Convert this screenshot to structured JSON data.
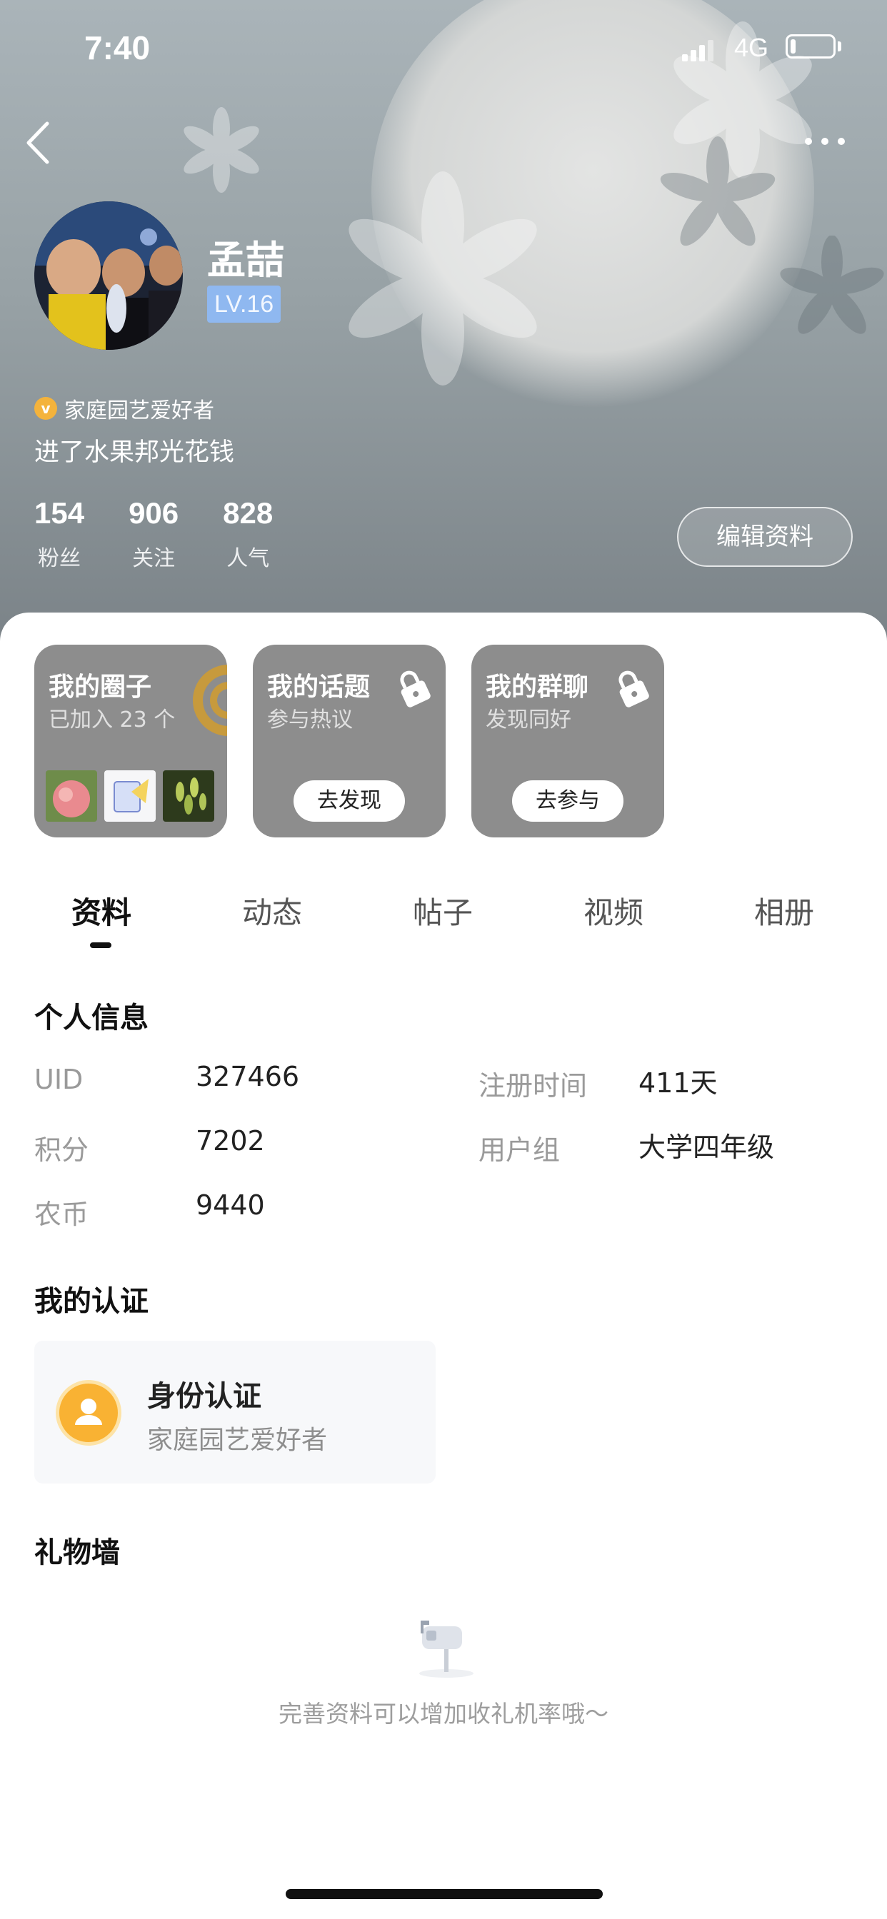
{
  "status_bar": {
    "time": "7:40",
    "network": "4G",
    "battery_level": 0.12
  },
  "profile": {
    "name": "孟喆",
    "level": "LV.16",
    "cert_title": "家庭园艺爱好者",
    "bio": "进了水果邦光花钱",
    "edit_label": "编辑资料"
  },
  "stats": [
    {
      "value": "154",
      "label": "粉丝"
    },
    {
      "value": "906",
      "label": "关注"
    },
    {
      "value": "828",
      "label": "人气"
    }
  ],
  "cards": {
    "circle": {
      "title": "我的圈子",
      "subtitle": "已加入 23 个"
    },
    "topic": {
      "title": "我的话题",
      "subtitle": "参与热议",
      "button": "去发现"
    },
    "group": {
      "title": "我的群聊",
      "subtitle": "发现同好",
      "button": "去参与"
    }
  },
  "tabs": [
    "资料",
    "动态",
    "帖子",
    "视频",
    "相册"
  ],
  "active_tab": "资料",
  "personal_info": {
    "title": "个人信息",
    "uid_label": "UID",
    "uid_value": "327466",
    "reg_label": "注册时间",
    "reg_value": "411天",
    "points_label": "积分",
    "points_value": "7202",
    "group_label": "用户组",
    "group_value": "大学四年级",
    "coins_label": "农币",
    "coins_value": "9440"
  },
  "certification": {
    "title": "我的认证",
    "card_title": "身份认证",
    "card_sub": "家庭园艺爱好者"
  },
  "gift_wall": {
    "title": "礼物墙",
    "empty_text": "完善资料可以增加收礼机率哦～"
  },
  "colors": {
    "header_top": "#aab4b9",
    "header_bottom": "#7b8388",
    "card_bg": "#8d8d8d",
    "level_badge": "#8fb8f0",
    "cert_yellow": "#f9b233"
  }
}
